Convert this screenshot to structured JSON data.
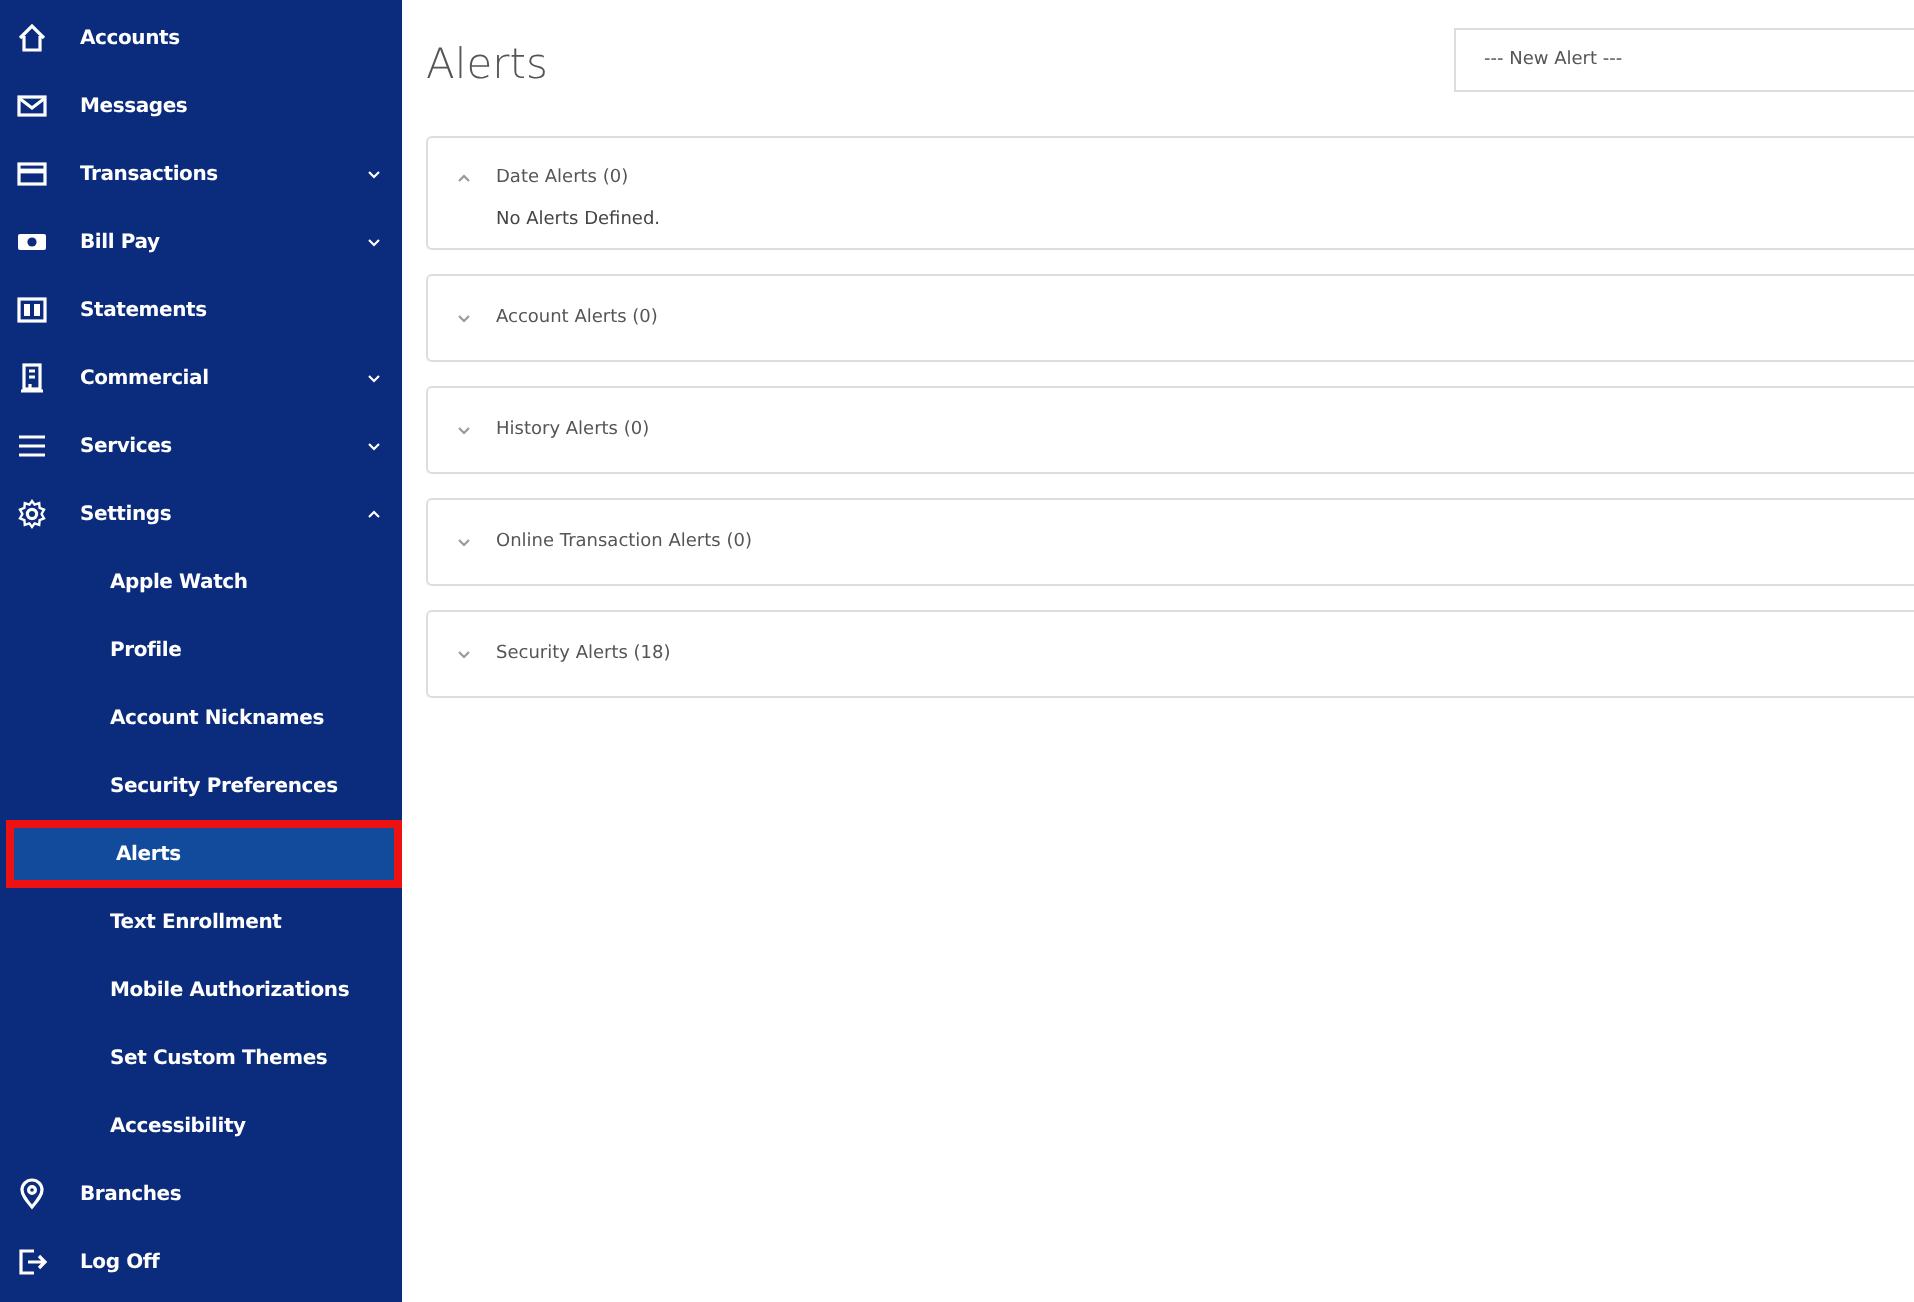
{
  "sidebar": {
    "items": [
      {
        "kind": "main",
        "label": "Accounts"
      },
      {
        "kind": "main",
        "label": "Messages"
      },
      {
        "kind": "main",
        "label": "Transactions",
        "expanded": false
      },
      {
        "kind": "main",
        "label": "Bill Pay",
        "expanded": false
      },
      {
        "kind": "main",
        "label": "Statements"
      },
      {
        "kind": "main",
        "label": "Commercial",
        "expanded": false
      },
      {
        "kind": "main",
        "label": "Services",
        "expanded": false
      },
      {
        "kind": "main",
        "label": "Settings",
        "expanded": true
      },
      {
        "kind": "sub",
        "label": "Apple Watch",
        "selected": false,
        "highlighted": false
      },
      {
        "kind": "sub",
        "label": "Profile",
        "selected": false,
        "highlighted": false
      },
      {
        "kind": "sub",
        "label": "Account Nicknames",
        "selected": false,
        "highlighted": false
      },
      {
        "kind": "sub",
        "label": "Security Preferences",
        "selected": false,
        "highlighted": false
      },
      {
        "kind": "sub",
        "label": "Alerts",
        "selected": true,
        "highlighted": true
      },
      {
        "kind": "sub",
        "label": "Text Enrollment",
        "selected": false,
        "highlighted": false
      },
      {
        "kind": "sub",
        "label": "Mobile Authorizations",
        "selected": false,
        "highlighted": false
      },
      {
        "kind": "sub",
        "label": "Set Custom Themes",
        "selected": false,
        "highlighted": false
      },
      {
        "kind": "sub",
        "label": "Accessibility",
        "selected": false,
        "highlighted": false
      },
      {
        "kind": "main",
        "label": "Branches"
      },
      {
        "kind": "main",
        "label": "Log Off"
      }
    ]
  },
  "page": {
    "title": "Alerts",
    "new_alert": {
      "value": "--- New Alert ---"
    }
  },
  "groups": [
    {
      "title": "Date Alerts (0)",
      "expanded": true,
      "message": "No Alerts Defined."
    },
    {
      "title": "Account Alerts (0)",
      "expanded": false
    },
    {
      "title": "History Alerts (0)",
      "expanded": false
    },
    {
      "title": "Online Transaction Alerts (0)",
      "expanded": false
    },
    {
      "title": "Security Alerts (18)",
      "expanded": false
    }
  ]
}
